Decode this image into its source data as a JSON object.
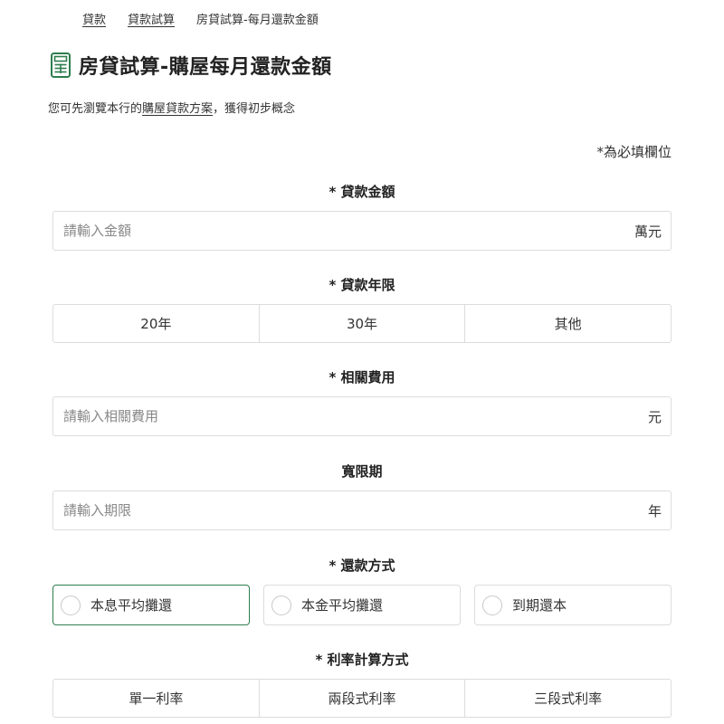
{
  "breadcrumb": {
    "items": [
      "貸款",
      "貸款試算"
    ],
    "current": "房貸試算-每月還款金額"
  },
  "page": {
    "title": "房貸試算-購屋每月還款金額",
    "accent_color": "#2e7d4f"
  },
  "intro": {
    "prefix": "您可先瀏覽本行的",
    "link": "購屋貸款方案",
    "suffix": "，獲得初步概念"
  },
  "required_note": "*為必填欄位",
  "loan_amount": {
    "label": "*  貸款金額",
    "placeholder": "請輸入金額",
    "unit": "萬元"
  },
  "loan_term": {
    "label": "*  貸款年限",
    "options": [
      "20年",
      "30年",
      "其他"
    ]
  },
  "fees": {
    "label": "*  相關費用",
    "placeholder": "請輸入相關費用",
    "unit": "元"
  },
  "grace": {
    "label": "寬限期",
    "placeholder": "請輸入期限",
    "unit": "年"
  },
  "repayment": {
    "label": "*  還款方式",
    "options": [
      "本息平均攤還",
      "本金平均攤還",
      "到期還本"
    ],
    "selected": "本息平均攤還"
  },
  "rate_method": {
    "label": "*  利率計算方式",
    "options": [
      "單一利率",
      "兩段式利率",
      "三段式利率"
    ]
  }
}
